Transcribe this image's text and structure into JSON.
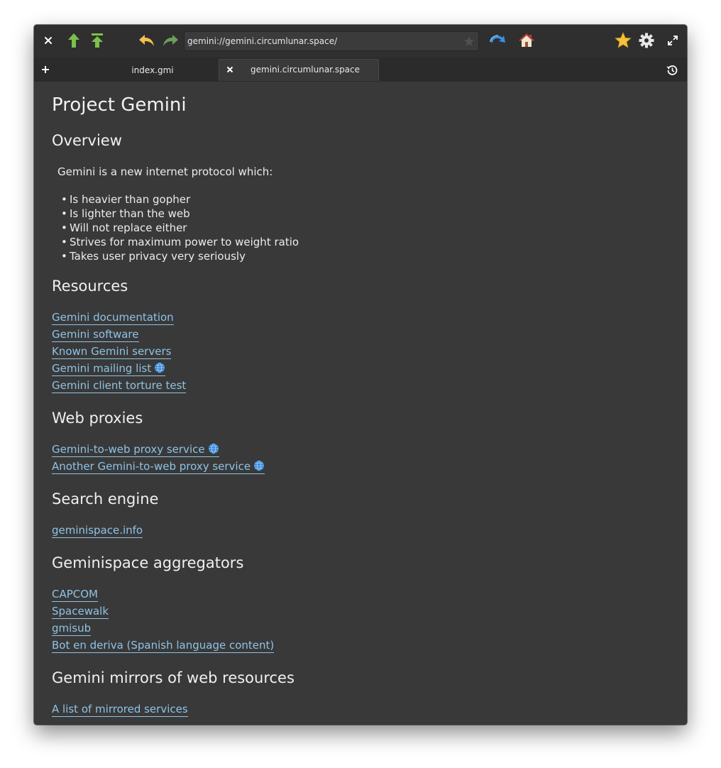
{
  "toolbar": {
    "url": "gemini://gemini.circumlunar.space/"
  },
  "tabs": [
    {
      "label": "index.gmi",
      "active": false
    },
    {
      "label": "gemini.circumlunar.space",
      "active": true
    }
  ],
  "page": {
    "title": "Project Gemini",
    "sections": {
      "overview": {
        "heading": "Overview",
        "intro": "Gemini is a new internet protocol which:",
        "bullets": [
          "Is heavier than gopher",
          "Is lighter than the web",
          "Will not replace either",
          "Strives for maximum power to weight ratio",
          "Takes user privacy very seriously"
        ]
      },
      "resources": {
        "heading": "Resources",
        "links": [
          "Gemini documentation",
          "Gemini software",
          "Known Gemini servers",
          "Gemini mailing list",
          "Gemini client torture test"
        ]
      },
      "web_proxies": {
        "heading": "Web proxies",
        "links": [
          "Gemini-to-web proxy service",
          "Another Gemini-to-web proxy service"
        ]
      },
      "search_engine": {
        "heading": "Search engine",
        "links": [
          "geminispace.info"
        ]
      },
      "aggregators": {
        "heading": "Geminispace aggregators",
        "links": [
          "CAPCOM",
          "Spacewalk",
          "gmisub",
          "Bot en deriva (Spanish language content)"
        ]
      },
      "mirrors": {
        "heading": "Gemini mirrors of web resources",
        "links": [
          "A list of mirrored services"
        ]
      }
    }
  },
  "colors": {
    "background": "#393939",
    "link": "#8ec3e6",
    "text": "#e8e8e8"
  }
}
